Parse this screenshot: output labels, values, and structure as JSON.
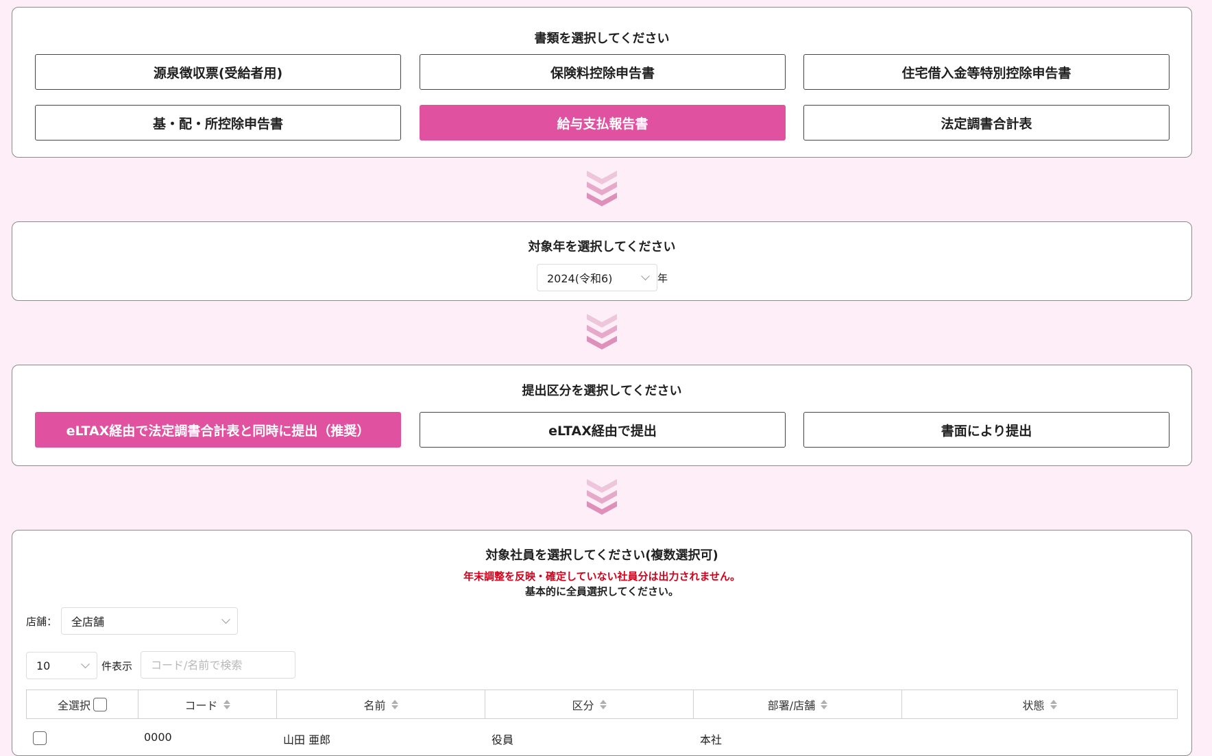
{
  "doc_section": {
    "title": "書類を選択してください",
    "options": [
      "源泉徴収票(受給者用)",
      "保険料控除申告書",
      "住宅借入金等特別控除申告書",
      "基・配・所控除申告書",
      "給与支払報告書",
      "法定調書合計表"
    ],
    "selected": "給与支払報告書"
  },
  "year_section": {
    "title": "対象年を選択してください",
    "selected_year": "2024(令和6)",
    "suffix": "年"
  },
  "submit_section": {
    "title": "提出区分を選択してください",
    "options": [
      "eLTAX経由で法定調書合計表と同時に提出（推奨）",
      "eLTAX経由で提出",
      "書面により提出"
    ],
    "selected": "eLTAX経由で法定調書合計表と同時に提出（推奨）"
  },
  "employee_section": {
    "title": "対象社員を選択してください(複数選択可)",
    "warning": "年末調整を反映・確定していない社員分は出力されません。",
    "note": "基本的に全員選択してください。",
    "store_label": "店舗：",
    "store_value": "全店舗",
    "page_size": "10",
    "page_size_label": "件表示",
    "search_placeholder": "コード/名前で検索",
    "columns": {
      "select_all": "全選択",
      "code": "コード",
      "name": "名前",
      "category": "区分",
      "dept": "部署/店舗",
      "status": "状態"
    },
    "rows": [
      {
        "code": "0000",
        "name": "山田 亜郎",
        "category": "役員",
        "dept": "本社",
        "status": ""
      }
    ]
  },
  "colors": {
    "accent": "#e0529f",
    "warning": "#d0021b",
    "background": "#fdeef7"
  },
  "icons": {
    "flow_arrow": "chevron-down-triple-icon"
  }
}
